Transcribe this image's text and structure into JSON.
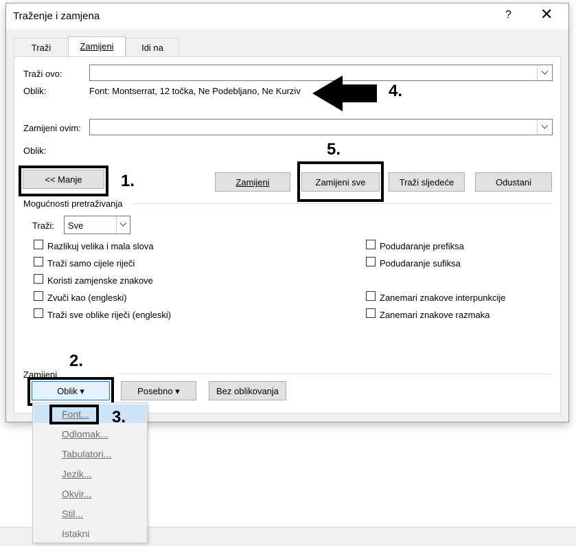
{
  "dialog": {
    "title": "Traženje i zamjena",
    "help_label": "?",
    "close_label": "✕"
  },
  "tabs": [
    {
      "label": "Traži"
    },
    {
      "label": "Zamijeni"
    },
    {
      "label": "Idi na"
    }
  ],
  "find": {
    "label": "Traži ovo:",
    "value": "",
    "format_label": "Oblik:",
    "format_value": "Font: Montserrat, 12 točka, Ne Podebljano, Ne Kurziv"
  },
  "replace": {
    "label": "Zamijeni ovim:",
    "value": "",
    "format_label": "Oblik:",
    "format_value": ""
  },
  "buttons": {
    "less": "<< Manje",
    "replace": "Zamijeni",
    "replace_all": "Zamijeni sve",
    "find_next": "Traži sljedeće",
    "cancel": "Odustani"
  },
  "search_options": {
    "section_label": "Mogućnosti pretraživanja",
    "search_label": "Traži:",
    "search_value": "Sve",
    "left": [
      {
        "label": "Razlikuj velika i mala slova",
        "checked": false
      },
      {
        "label": "Traži samo cijele riječi",
        "checked": false
      },
      {
        "label": "Koristi zamjenske znakove",
        "checked": false
      },
      {
        "label": "Zvuči kao (engleski)",
        "checked": false
      },
      {
        "label": "Traži sve oblike riječi (engleski)",
        "checked": false
      }
    ],
    "right": [
      {
        "label": "Podudaranje prefiksa",
        "checked": false
      },
      {
        "label": "Podudaranje sufiksa",
        "checked": false
      },
      {
        "label": "Zanemari znakove interpunkcije",
        "checked": false
      },
      {
        "label": "Zanemari znakove razmaka",
        "checked": false
      }
    ]
  },
  "replace_section": {
    "label": "Zamijeni",
    "format_button": "Oblik ▾",
    "special_button": "Posebno ▾",
    "no_format_button": "Bez oblikovanja"
  },
  "format_menu": [
    {
      "label": "Font..."
    },
    {
      "label": "Odlomak..."
    },
    {
      "label": "Tabulatori..."
    },
    {
      "label": "Jezik..."
    },
    {
      "label": "Okvir..."
    },
    {
      "label": "Stil..."
    },
    {
      "label": "Istakni"
    }
  ],
  "annotations": {
    "n1": "1.",
    "n2": "2.",
    "n3": "3.",
    "n4": "4.",
    "n5": "5."
  }
}
